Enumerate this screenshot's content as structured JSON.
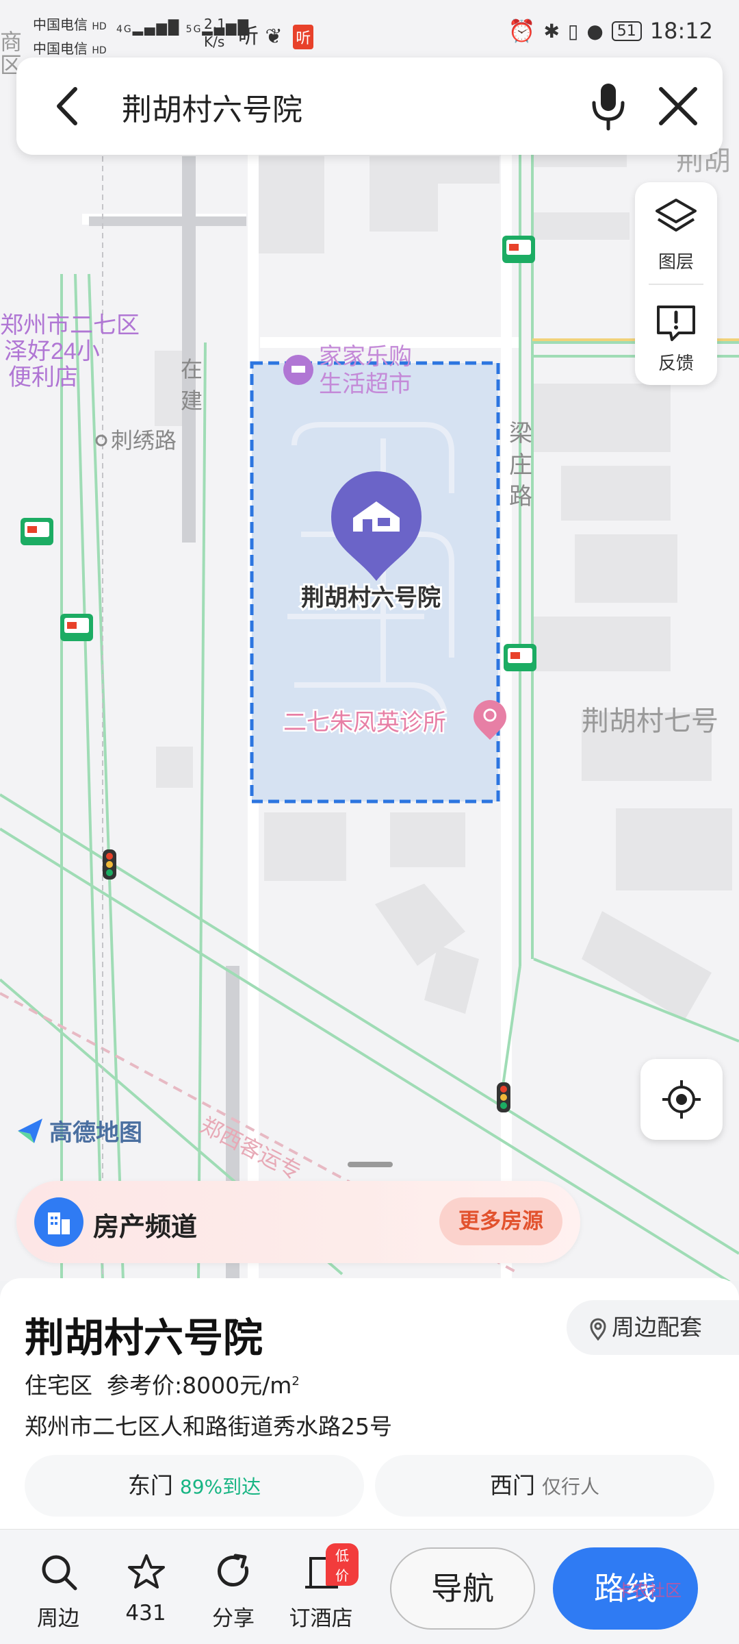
{
  "status_bar": {
    "carrier1": "中国电信",
    "carrier2": "中国电信",
    "hd": "HD",
    "network1": "4G",
    "network2": "5G",
    "speed": "2.1",
    "speed_unit": "K/s",
    "app_icon_text": "听",
    "battery": "51",
    "time": "18:12"
  },
  "search": {
    "query": "荆胡村六号院"
  },
  "map": {
    "labels": {
      "top_left_a": "商",
      "top_left_b": "区",
      "top_right": "荆胡",
      "poi_store_1": "郑州市二七区",
      "poi_store_2": "泽好24小",
      "poi_store_3": "便利店",
      "building_status_1": "在",
      "building_status_2": "建",
      "road_cixiu": "刺绣路",
      "poi_supermarket_1": "家家乐购",
      "poi_supermarket_2": "生活超市",
      "road_liangzhuang_1": "梁",
      "road_liangzhuang_2": "庄",
      "road_liangzhuang_3": "路",
      "marker_label": "荆胡村六号院",
      "poi_clinic": "二七朱凤英诊所",
      "neighbor": "荆胡村七号",
      "road_zhengxi": "郑西客运专"
    },
    "logo": "高德地图"
  },
  "tools": {
    "layers": "图层",
    "feedback": "反馈"
  },
  "banner": {
    "title": "房产频道",
    "more": "更多房源"
  },
  "place": {
    "name": "荆胡村六号院",
    "nearby": "周边配套",
    "type": "住宅区",
    "price_label": "参考价:",
    "price": "8000元/m",
    "price_sup": "2",
    "address": "郑州市二七区人和路街道秀水路25号",
    "gates": [
      {
        "name": "东门",
        "note": "89%到达"
      },
      {
        "name": "西门",
        "note": "仅行人"
      }
    ]
  },
  "bottom_bar": {
    "nearby": "周边",
    "favorites": "431",
    "share": "分享",
    "hotel": "订酒店",
    "hotel_badge": "低价",
    "navigate": "导航",
    "route": "路线",
    "watermark": "卡农社区"
  },
  "colors": {
    "accent_blue": "#2f7bf3",
    "road_green": "#9fdcb5",
    "area_fill": "#d6e2f2",
    "area_border": "#2c75e0",
    "poi_pink": "#e77fa5",
    "poi_purple": "#b076d4",
    "marker_purple": "#6b64c8"
  }
}
